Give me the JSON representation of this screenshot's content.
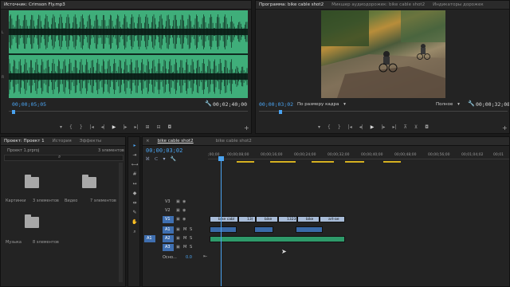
{
  "source_panel": {
    "title": "Источник: Crimson Fly.mp3",
    "timecode_left": "00;00;05;05",
    "timecode_right": "00;02;40;00",
    "ruler_ticks": [
      "L",
      "R"
    ]
  },
  "program_panel": {
    "tabs": [
      "Программа: bike cable shot2",
      "Микшер аудиодорожек: bike cable shot2",
      "Индикаторы дорожек"
    ],
    "timecode_left": "00;00;03;02",
    "fit_label": "По размеру кадра",
    "quality_label": "Полное",
    "timecode_right": "00;00;32;08"
  },
  "project_panel": {
    "tabs": [
      "Проект: Проект 1",
      "История",
      "Эффекты"
    ],
    "project_file": "Проект 1.prproj",
    "item_count": "3 элементов",
    "items": [
      {
        "name": "Картинки",
        "count": "3 элементов"
      },
      {
        "name": "Видео",
        "count": "7 элементов"
      },
      {
        "name": "Музыка",
        "count": "8 элементов"
      }
    ]
  },
  "timeline": {
    "tabs": [
      "bike cable shot2",
      "bike cable shot2"
    ],
    "timecode": "00;00;03;02",
    "ruler": [
      ";00;00",
      "00;00;08;00",
      "00;00;16;00",
      "00;00;24;00",
      "00;00;32;00",
      "00;00;40;00",
      "00;00;48;00",
      "00;00;56;00",
      "00;01;04;02",
      "00;01"
    ],
    "tracks": [
      {
        "name": "V3",
        "type": "video"
      },
      {
        "name": "V2",
        "type": "video"
      },
      {
        "name": "V1",
        "type": "video"
      },
      {
        "name": "A1",
        "type": "audio"
      },
      {
        "name": "A2",
        "type": "audio"
      },
      {
        "name": "A3",
        "type": "audio"
      }
    ],
    "src_patch": "A1",
    "master_label": "Осно...",
    "master_value": "0.0",
    "video_clips": [
      "bike cabl",
      "13(",
      "bike",
      "1323",
      "bike",
      "art-ae"
    ],
    "track_buttons": {
      "M": "M",
      "S": "S"
    }
  },
  "colors": {
    "waveform": "#3fae7a",
    "accent_blue": "#4aa3f0",
    "video_clip": "#a8bcd8",
    "audio_clip": "#2e9a6a",
    "audio_clip_light": "#4a7fbf"
  },
  "tools": [
    "selection",
    "track-select",
    "ripple",
    "razor",
    "slip",
    "pen",
    "hand",
    "zoom"
  ]
}
